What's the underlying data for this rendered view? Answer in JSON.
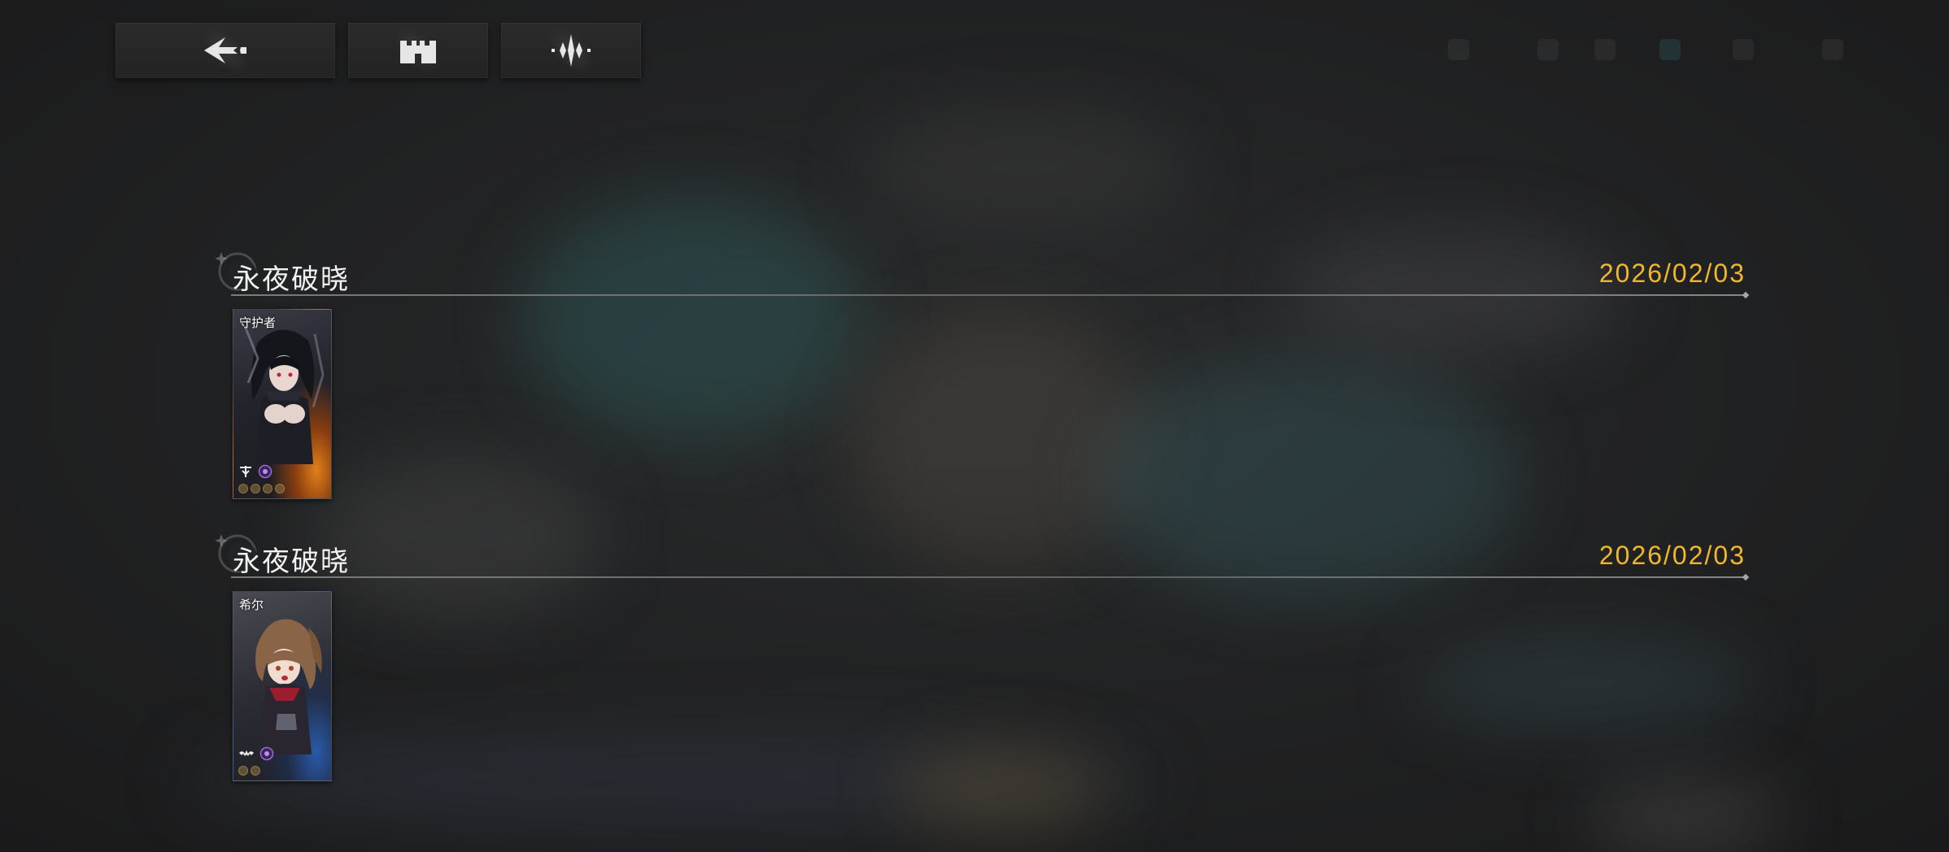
{
  "topbar": {
    "buttons": [
      {
        "name": "back-button",
        "icon": "back-arrow-icon"
      },
      {
        "name": "base-button",
        "icon": "castle-icon"
      },
      {
        "name": "audio-button",
        "icon": "sound-wave-icon"
      }
    ]
  },
  "entries": [
    {
      "title": "永夜破晓",
      "date": "2026/02/03",
      "card": {
        "name": "守护者",
        "class_icon": "sword-class-icon",
        "element_icon": "purple-element-icon",
        "stars": 4
      }
    },
    {
      "title": "永夜破晓",
      "date": "2026/02/03",
      "card": {
        "name": "希尔",
        "class_icon": "bat-class-icon",
        "element_icon": "purple-element-icon",
        "stars": 2
      }
    }
  ],
  "colors": {
    "date": "#f0b72a",
    "title": "#f2f2f2",
    "background": "#1c1c1d"
  }
}
